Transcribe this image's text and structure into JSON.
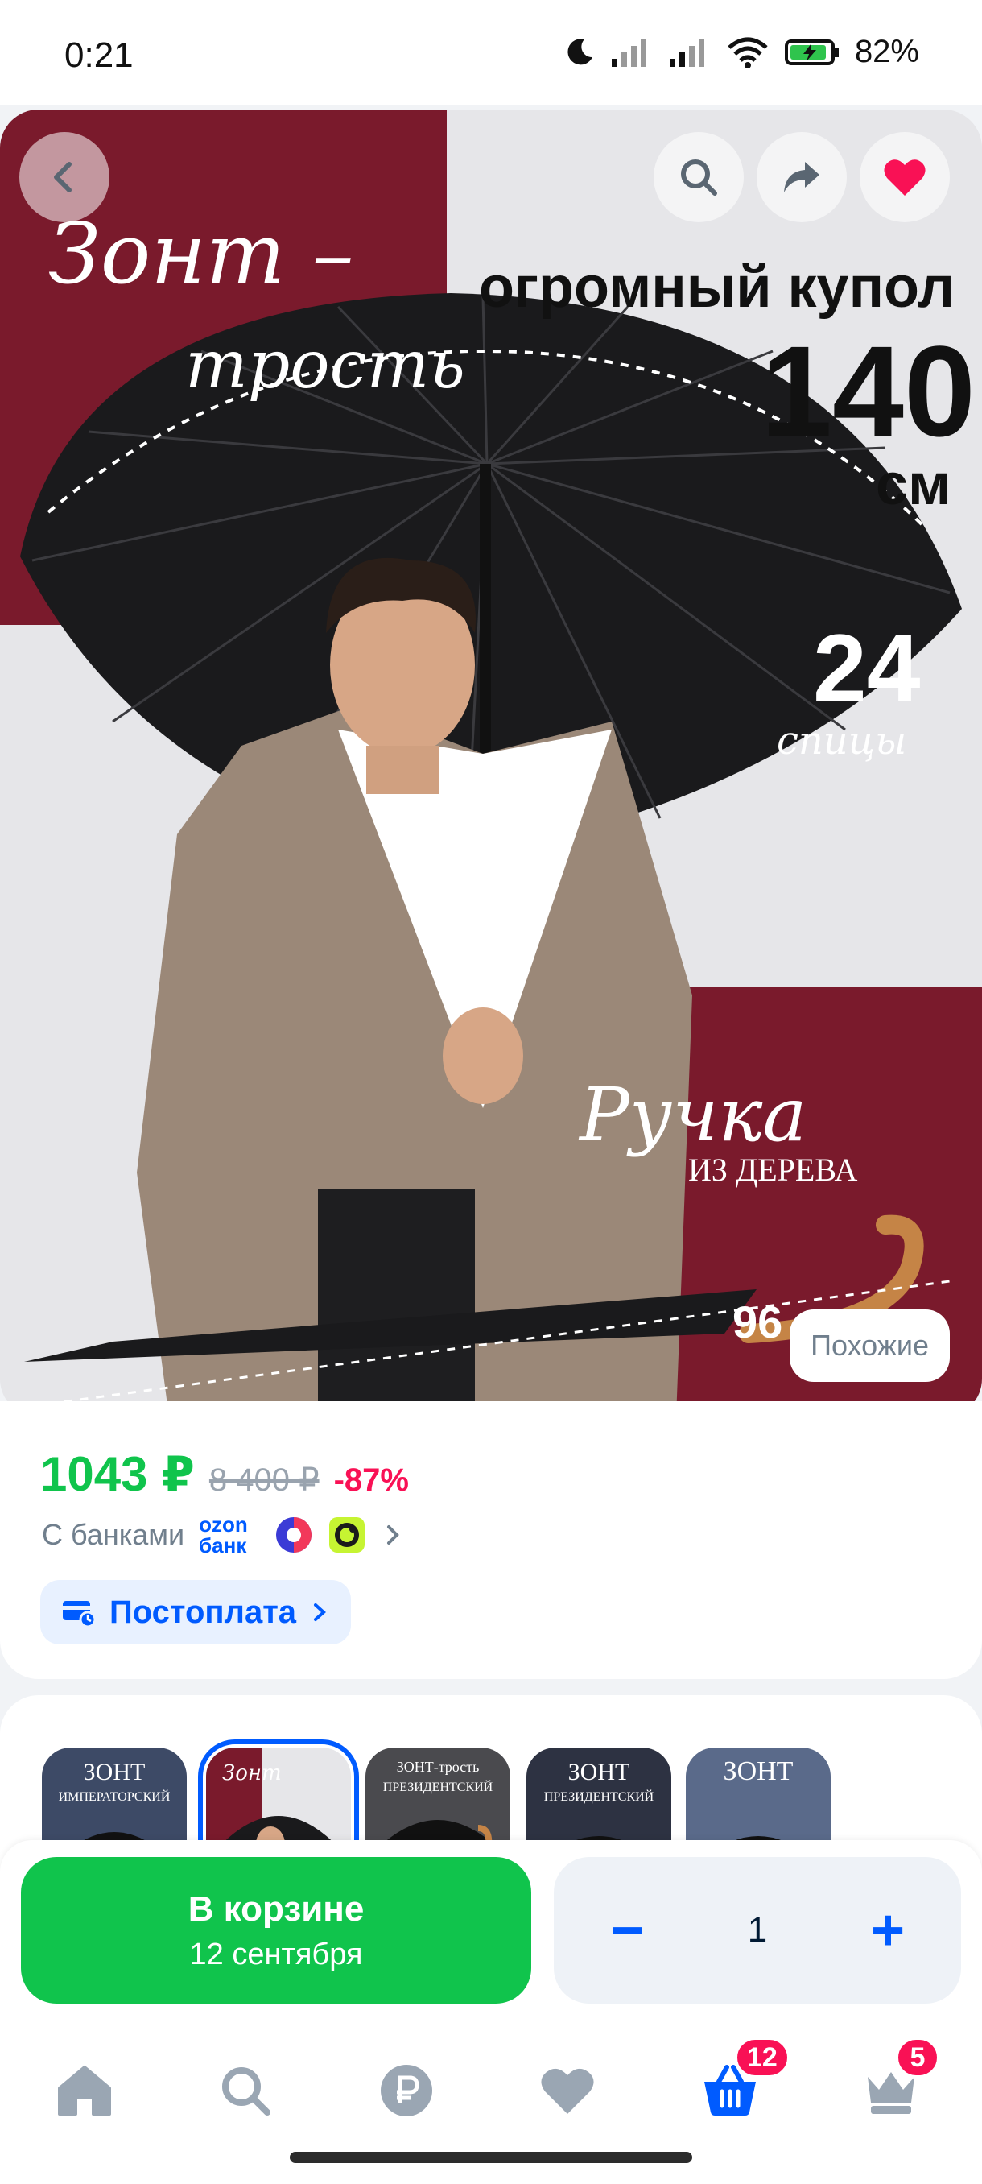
{
  "status_bar": {
    "time": "0:21",
    "battery": "82%"
  },
  "hero": {
    "title_line1": "Зонт –",
    "title_line2": "трость",
    "dome_label": "огромный купол",
    "dome_size": "140",
    "dome_unit": "см",
    "spokes_count": "24",
    "spokes_label": "спицы",
    "handle_line1": "Ручка",
    "handle_line2": "ИЗ ДЕРЕВА",
    "length_label": "96 см",
    "similar_label": "Похожие",
    "colors": {
      "maroon": "#7a1a2c",
      "backdrop": "#e6e6e9"
    }
  },
  "price": {
    "current": "1043 ₽",
    "old": "8 400 ₽",
    "discount": "-87%",
    "banks_label": "С банками",
    "ozon_line1": "ozon",
    "ozon_line2": "банк",
    "postpay_label": "Постоплата"
  },
  "thumbnails": [
    {
      "caption": "ЗОНТ",
      "sub": "ИМПЕРАТОРСКИЙ"
    },
    {
      "caption": "Зонт",
      "sub": "",
      "selected": true
    },
    {
      "caption": "ЗОНТ-трость",
      "sub": "ПРЕЗИДЕНТСКИЙ"
    },
    {
      "caption": "ЗОНТ",
      "sub": "ПРЕЗИДЕНТСКИЙ"
    },
    {
      "caption": "ЗОНТ",
      "sub": ""
    }
  ],
  "cart": {
    "button_line1": "В корзине",
    "button_line2": "12 сентября",
    "minus": "−",
    "quantity": "1",
    "plus": "+"
  },
  "tabbar": {
    "items": [
      {
        "icon": "home-icon"
      },
      {
        "icon": "search-icon"
      },
      {
        "icon": "ruble-icon"
      },
      {
        "icon": "heart-icon"
      },
      {
        "icon": "basket-icon",
        "badge": "12",
        "active": true
      },
      {
        "icon": "crown-icon",
        "badge": "5"
      }
    ]
  }
}
